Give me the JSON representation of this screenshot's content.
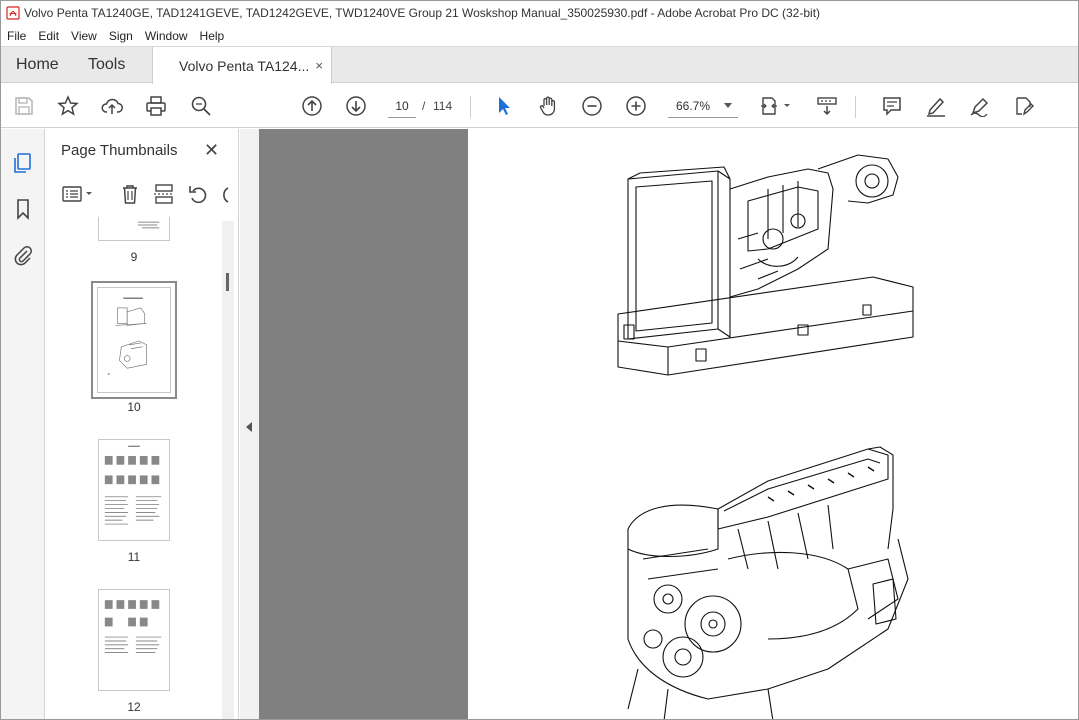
{
  "window": {
    "title": "Volvo Penta TA1240GE, TAD1241GEVE, TAD1242GEVE, TWD1240VE Group 21 Woskshop Manual_350025930.pdf - Adobe Acrobat Pro DC (32-bit)"
  },
  "menu": [
    "File",
    "Edit",
    "View",
    "Sign",
    "Window",
    "Help"
  ],
  "tabs": {
    "home": "Home",
    "tools": "Tools",
    "document": "Volvo Penta TA124...",
    "close_glyph": "×"
  },
  "toolbar": {
    "current_page": "10",
    "separator": "/",
    "total_pages": "114",
    "zoom": "66.7%"
  },
  "panel": {
    "title": "Page Thumbnails",
    "close_glyph": "✕"
  },
  "thumbnails": [
    {
      "label": "9"
    },
    {
      "label": "10",
      "selected": true
    },
    {
      "label": "11"
    },
    {
      "label": "12"
    }
  ],
  "colors": {
    "accent_blue": "#1e6fd9",
    "pdf_red": "#d8251d",
    "doc_background": "#808080"
  }
}
